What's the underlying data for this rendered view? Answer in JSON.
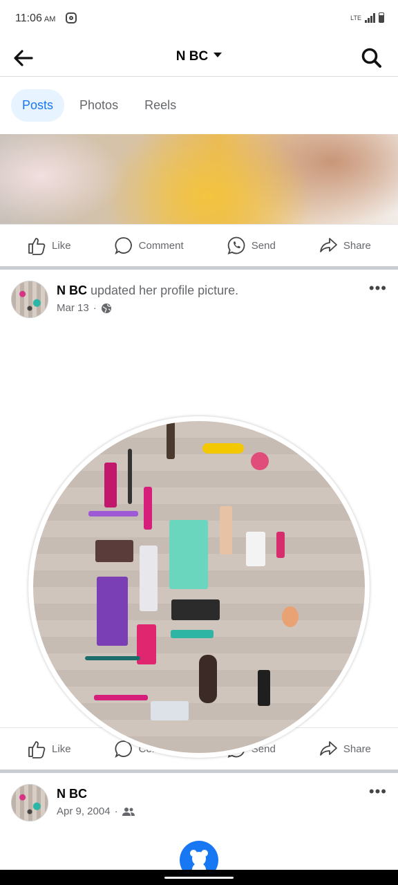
{
  "status_bar": {
    "time": "11:06",
    "ampm": "AM",
    "network": "LTE"
  },
  "header": {
    "title": "N BC"
  },
  "tabs": [
    {
      "label": "Posts"
    },
    {
      "label": "Photos"
    },
    {
      "label": "Reels"
    }
  ],
  "actions": {
    "like": "Like",
    "comment": "Comment",
    "send": "Send",
    "share": "Share"
  },
  "post1": {
    "author": "N BC",
    "text": "updated her profile picture.",
    "date": "Mar 13",
    "separator": "·",
    "privacy_icon": "globe-icon"
  },
  "post2": {
    "author": "N BC",
    "date": "Apr 9, 2004",
    "separator": "·",
    "privacy_icon": "friends-icon"
  },
  "more_label": "•••"
}
